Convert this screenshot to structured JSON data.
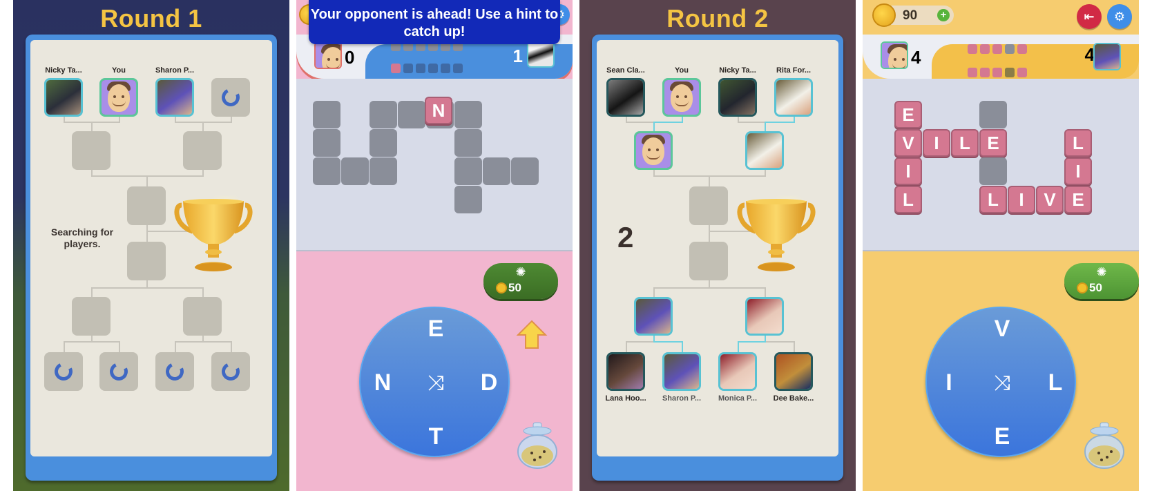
{
  "panel1": {
    "title": "Round 1",
    "status_text": "Searching for players.",
    "top_players": [
      {
        "name": "Nicky Ta...",
        "type": "photo",
        "colors": [
          "#4f6b3e",
          "#2b2f3a",
          "#a48e7a"
        ]
      },
      {
        "name": "You",
        "type": "self"
      },
      {
        "name": "Sharon P...",
        "type": "photo",
        "colors": [
          "#5a5a3a",
          "#5e52b8",
          "#d8b48c"
        ]
      },
      {
        "name": "",
        "type": "loading"
      }
    ],
    "bottom_slots": [
      "loading",
      "loading",
      "loading",
      "loading"
    ]
  },
  "panel2": {
    "tooltip": "Your opponent is ahead! Use a hint to catch up!",
    "player_score": "0",
    "opponent_score": "1",
    "player_pips": [
      "grey",
      "grey",
      "grey",
      "grey",
      "grey",
      "grey"
    ],
    "opponent_pips": [
      "pink",
      "dark",
      "dark",
      "dark",
      "dark",
      "dark"
    ],
    "revealed_letter": "N",
    "wheel_letters": {
      "top": "E",
      "left": "N",
      "right": "D",
      "bottom": "T"
    },
    "hint_cost": "50",
    "colors": {
      "background": "#f2b6cf",
      "tile_filled": "#d47891",
      "tile_empty": "#8a8e99",
      "tooltip": "#1229b8"
    }
  },
  "panel3": {
    "title": "Round 2",
    "round_number": "2",
    "top_players": [
      {
        "name": "Sean Cla...",
        "type": "photo",
        "style": "dim",
        "colors": [
          "#9a9a9a",
          "#1a1a1a",
          "#cfcfcf"
        ]
      },
      {
        "name": "You",
        "type": "self"
      },
      {
        "name": "Nicky Ta...",
        "type": "photo",
        "style": "dim",
        "colors": [
          "#4f6b3e",
          "#2b2f3a",
          "#a48e7a"
        ]
      },
      {
        "name": "Rita For...",
        "type": "photo",
        "colors": [
          "#6a5e3c",
          "#f2f0e8",
          "#d9a27e"
        ]
      }
    ],
    "semifinal_top": [
      {
        "type": "self"
      },
      {
        "type": "photo",
        "colors": [
          "#6a5e3c",
          "#f2f0e8",
          "#d9a27e"
        ]
      }
    ],
    "semifinal_bottom": [
      {
        "type": "photo",
        "colors": [
          "#5a5a3a",
          "#5e52b8",
          "#d8b48c"
        ]
      },
      {
        "type": "photo",
        "colors": [
          "#8e1f2a",
          "#e8c8b8",
          "#f3dccd"
        ]
      }
    ],
    "bottom_players": [
      {
        "name": "Lana Hoo...",
        "type": "photo",
        "style": "dim",
        "colors": [
          "#2a1f22",
          "#7e5a4a",
          "#c89ad8"
        ]
      },
      {
        "name": "Sharon P...",
        "type": "photo",
        "style": "grey",
        "colors": [
          "#5a5a3a",
          "#5e52b8",
          "#d8b48c"
        ]
      },
      {
        "name": "Monica P...",
        "type": "photo",
        "style": "grey",
        "colors": [
          "#8e1f2a",
          "#e8c8b8",
          "#f3dccd"
        ]
      },
      {
        "name": "Dee Bake...",
        "type": "photo",
        "style": "dim",
        "colors": [
          "#d8662a",
          "#f2b24a",
          "#1e3a7a"
        ]
      }
    ]
  },
  "panel4": {
    "coins": "90",
    "player_score": "4",
    "opponent_score": "4",
    "player_pips": [
      "pink",
      "pink",
      "pink",
      "grey",
      "pink"
    ],
    "opponent_pips": [
      "pink",
      "pink",
      "pink",
      "olive",
      "pink"
    ],
    "grid_tiles": [
      {
        "r": 0,
        "c": 0,
        "letter": "E"
      },
      {
        "r": 0,
        "c": 3,
        "letter": ""
      },
      {
        "r": 1,
        "c": 0,
        "letter": "V"
      },
      {
        "r": 1,
        "c": 1,
        "letter": "I"
      },
      {
        "r": 1,
        "c": 2,
        "letter": "L"
      },
      {
        "r": 1,
        "c": 3,
        "letter": "E"
      },
      {
        "r": 1,
        "c": 6,
        "letter": "L"
      },
      {
        "r": 2,
        "c": 0,
        "letter": "I"
      },
      {
        "r": 2,
        "c": 3,
        "letter": ""
      },
      {
        "r": 2,
        "c": 6,
        "letter": "I"
      },
      {
        "r": 3,
        "c": 0,
        "letter": "L"
      },
      {
        "r": 3,
        "c": 3,
        "letter": "L"
      },
      {
        "r": 3,
        "c": 4,
        "letter": "I"
      },
      {
        "r": 3,
        "c": 5,
        "letter": "V"
      },
      {
        "r": 3,
        "c": 6,
        "letter": "E"
      }
    ],
    "wheel_letters": {
      "top": "V",
      "left": "I",
      "right": "L",
      "bottom": "E"
    },
    "hint_cost": "50",
    "colors": {
      "background": "#f6cc6f",
      "exit_button": "#d12a45",
      "settings_button": "#3f8ee8"
    }
  },
  "icons": {
    "loading": "loading-spinner-icon",
    "trophy": "trophy-icon",
    "shuffle": "⤨",
    "bulb": "✺",
    "exit": "⇤",
    "settings": "⚙",
    "plus": "+"
  }
}
